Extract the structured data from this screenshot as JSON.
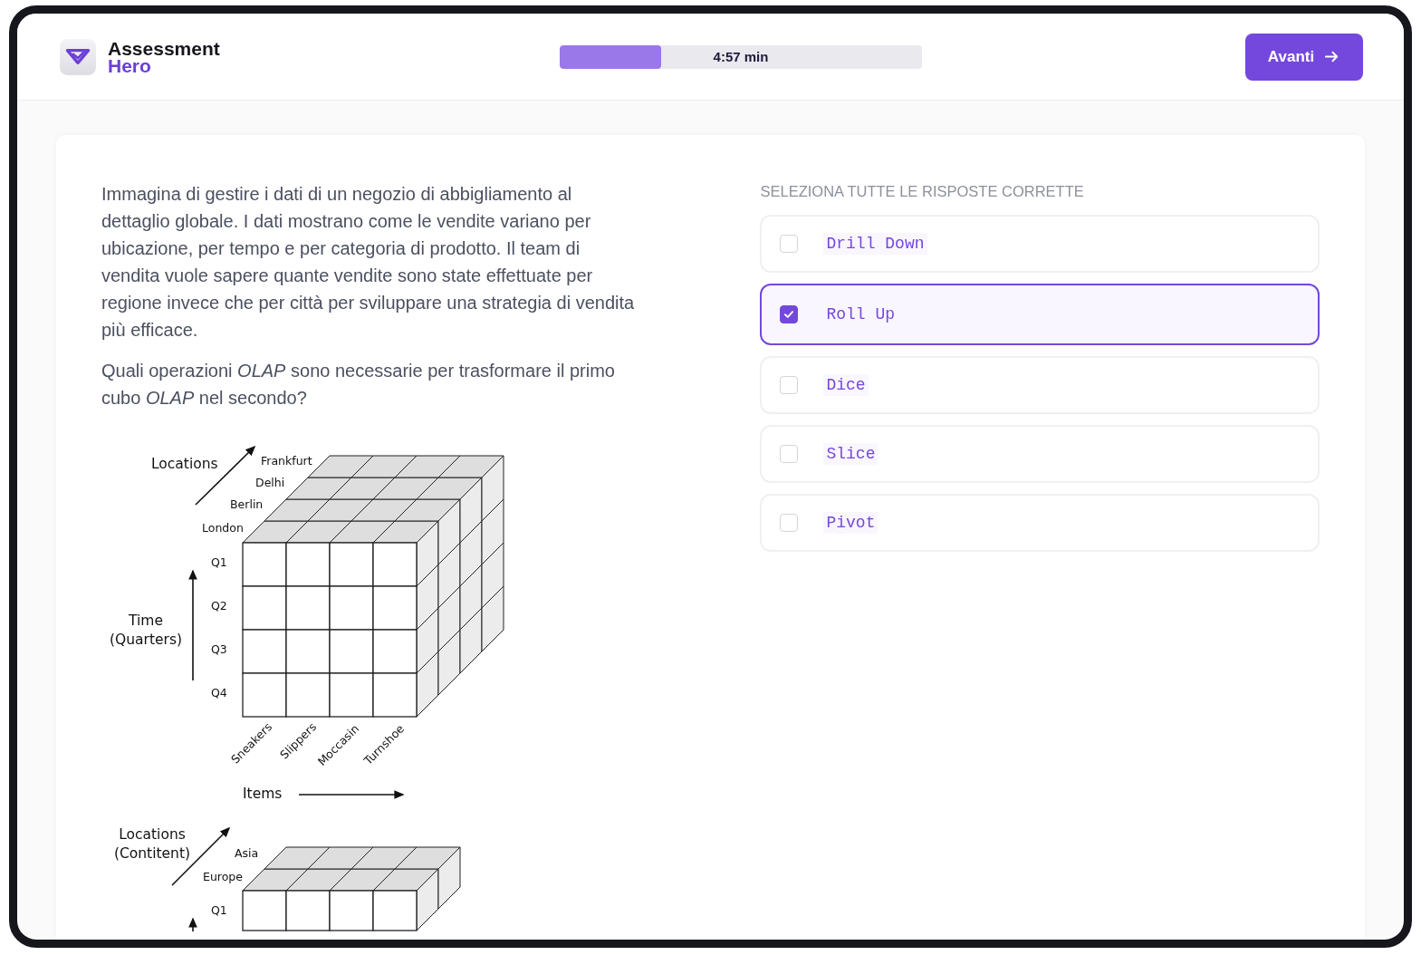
{
  "brand": {
    "name": "Assessment",
    "sub": "Hero"
  },
  "timer": {
    "level": 0.28,
    "label": "4:57 min"
  },
  "next_button": {
    "label": "Avanti"
  },
  "question": {
    "paragraphs": [
      "Immagina di gestire i dati di un negozio di abbigliamento al dettaglio globale. I dati mostrano come le vendite variano per ubicazione, per tempo e per categoria di prodotto. Il team di vendita vuole sapere quante vendite sono state effettuate per regione invece che per città per sviluppare una strategia di vendita più efficace.",
      "Quali operazioni *OLAP* sono necessarie per trasformare il primo cubo *OLAP* nel secondo?"
    ],
    "figure": {
      "cube_1": {
        "depth_title": "Locations",
        "depth_labels": [
          "Frankfurt",
          "Delhi",
          "Berlin",
          "London"
        ],
        "vertical_title": [
          "Time",
          "(Quarters)"
        ],
        "rows": [
          "Q1",
          "Q2",
          "Q3",
          "Q4"
        ],
        "items": [
          "Sneakers",
          "Slippers",
          "Moccasin",
          "Turnshoe"
        ],
        "items_title": "Items"
      },
      "cube_2": {
        "depth_title": [
          "Locations",
          "(Contitent)"
        ],
        "depth_labels": [
          "Asia",
          "Europe"
        ],
        "rows": [
          "Q1"
        ]
      }
    }
  },
  "answers": {
    "instruction": "SELEZIONA TUTTE LE RISPOSTE CORRETTE",
    "options": [
      {
        "label": "Drill Down",
        "checked": false
      },
      {
        "label": "Roll Up",
        "checked": true
      },
      {
        "label": "Dice",
        "checked": false
      },
      {
        "label": "Slice",
        "checked": false
      },
      {
        "label": "Pivot",
        "checked": false
      }
    ]
  }
}
